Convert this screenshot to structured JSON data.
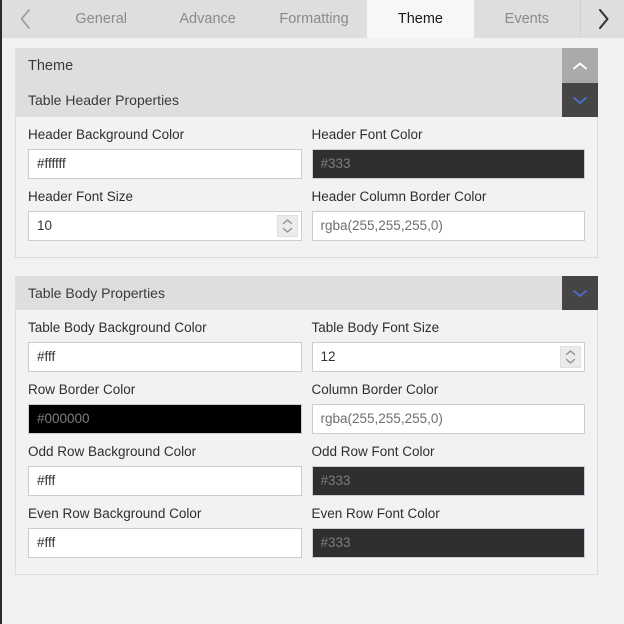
{
  "tabbar": {
    "prev_arrow": "chevron-left",
    "next_arrow": "chevron-right",
    "tabs": [
      {
        "label": "General",
        "active": false
      },
      {
        "label": "Advance",
        "active": false
      },
      {
        "label": "Formatting",
        "active": false
      },
      {
        "label": "Theme",
        "active": true
      },
      {
        "label": "Events",
        "active": false
      }
    ]
  },
  "accordion": {
    "title": "Theme",
    "toggle_icon": "chevron-up"
  },
  "groups": [
    {
      "title": "Table Header Properties",
      "toggle_icon": "chevron-down",
      "rows": [
        [
          {
            "label": "Header Background Color",
            "value": "#ffffff",
            "style": "light",
            "kind": "text"
          },
          {
            "label": "Header Font Color",
            "value": "#333",
            "style": "dark",
            "kind": "text"
          }
        ],
        [
          {
            "label": "Header Font Size",
            "value": "10",
            "style": "light",
            "kind": "number"
          },
          {
            "label": "Header Column Border Color",
            "value": "rgba(255,255,255,0)",
            "style": "muted",
            "kind": "text"
          }
        ]
      ]
    },
    {
      "title": "Table Body Properties",
      "toggle_icon": "chevron-down",
      "rows": [
        [
          {
            "label": "Table Body Background Color",
            "value": "#fff",
            "style": "light",
            "kind": "text"
          },
          {
            "label": "Table Body Font Size",
            "value": "12",
            "style": "light",
            "kind": "number"
          }
        ],
        [
          {
            "label": "Row Border Color",
            "value": "#000000",
            "style": "black",
            "kind": "text"
          },
          {
            "label": "Column Border Color",
            "value": "rgba(255,255,255,0)",
            "style": "muted",
            "kind": "text"
          }
        ],
        [
          {
            "label": "Odd Row Background Color",
            "value": "#fff",
            "style": "light",
            "kind": "text"
          },
          {
            "label": "Odd Row Font Color",
            "value": "#333",
            "style": "dark",
            "kind": "text"
          }
        ],
        [
          {
            "label": "Even Row Background Color",
            "value": "#fff",
            "style": "light",
            "kind": "text"
          },
          {
            "label": "Even Row Font Color",
            "value": "#333",
            "style": "dark",
            "kind": "text"
          }
        ]
      ]
    }
  ],
  "colors": {
    "tabbar_bg": "#dedede",
    "active_tab_bg": "#f7f7f7",
    "panel_bg": "#f2f2f2",
    "page_bg": "#f1f1f1",
    "header_bar_bg": "#dedede",
    "outer_toggle_bg": "#aaaaaa",
    "inner_toggle_bg": "#454545",
    "toggle_accent": "#4a6fd0",
    "dark_field_bg": "#2f2f2f",
    "black_field_bg": "#000000",
    "input_border": "#c6cdd6"
  }
}
